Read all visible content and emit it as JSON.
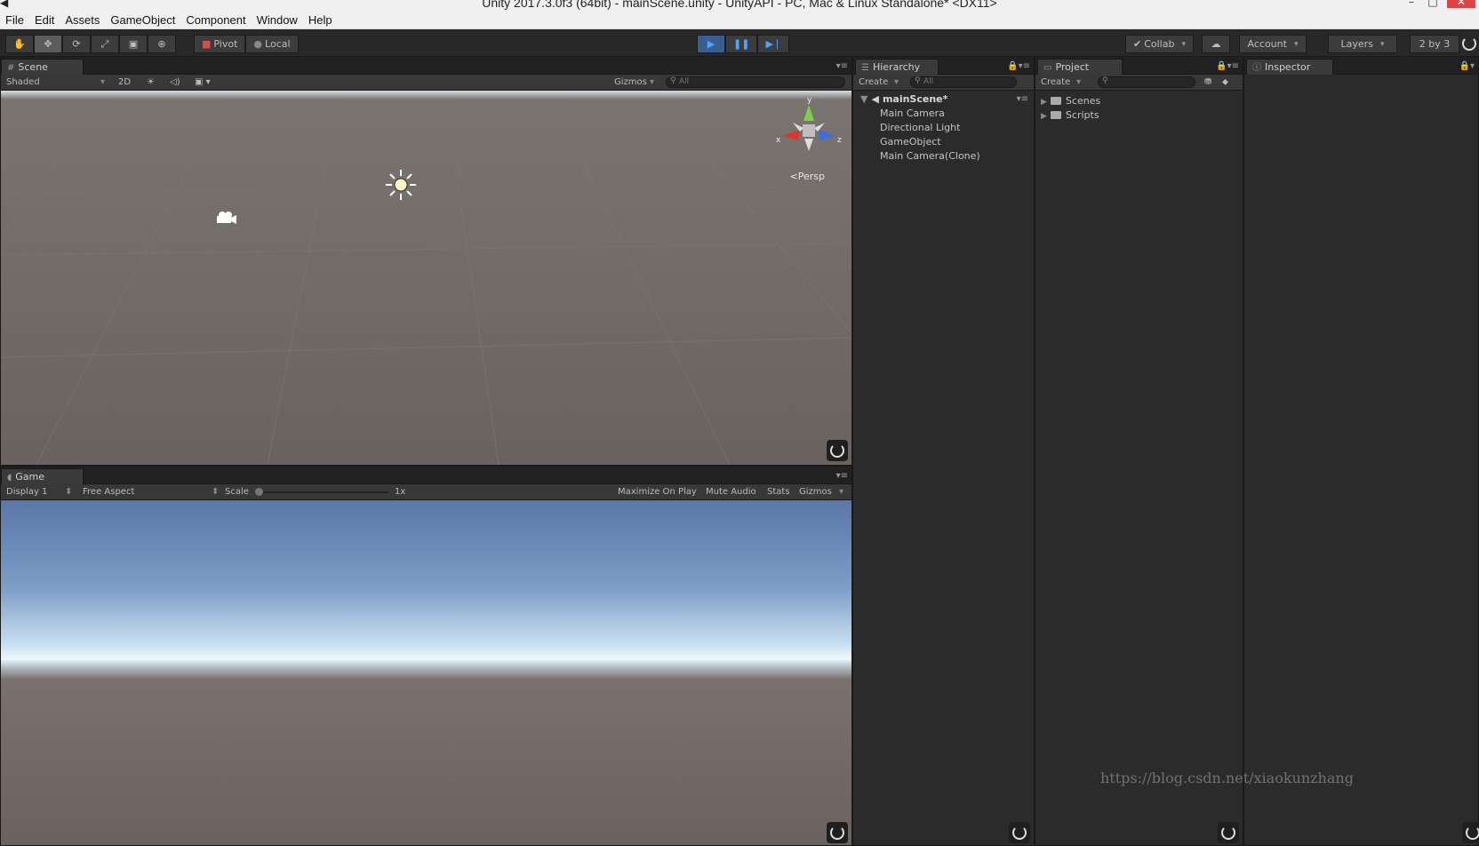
{
  "window": {
    "title": "Unity 2017.3.0f3 (64bit) - mainScene.unity - UnityAPI - PC, Mac & Linux Standalone* <DX11>"
  },
  "menu": [
    "File",
    "Edit",
    "Assets",
    "GameObject",
    "Component",
    "Window",
    "Help"
  ],
  "toolbar": {
    "tools": [
      "hand-tool",
      "move-tool",
      "rotate-tool",
      "scale-tool",
      "rect-tool",
      "transform-tool"
    ],
    "pivot_label": "Pivot",
    "local_label": "Local",
    "collab_label": "Collab",
    "account_label": "Account",
    "layers_label": "Layers",
    "layout_label": "2 by 3"
  },
  "scene": {
    "tab_label": "Scene",
    "shading": "Shaded",
    "mode_2d": "2D",
    "gizmos_label": "Gizmos",
    "search_placeholder": "All",
    "projection_label": "Persp",
    "axis_labels": [
      "y",
      "x",
      "z"
    ]
  },
  "game": {
    "tab_label": "Game",
    "display": "Display 1",
    "aspect": "Free Aspect",
    "scale_label": "Scale",
    "scale_value": "1x",
    "maximize_label": "Maximize On Play",
    "mute_label": "Mute Audio",
    "stats_label": "Stats",
    "gizmos_label": "Gizmos"
  },
  "hierarchy": {
    "tab_label": "Hierarchy",
    "create_label": "Create",
    "search_placeholder": "All",
    "scene_name": "mainScene*",
    "items": [
      "Main Camera",
      "Directional Light",
      "GameObject",
      "Main Camera(Clone)"
    ]
  },
  "project": {
    "tab_label": "Project",
    "create_label": "Create",
    "folders": [
      "Scenes",
      "Scripts"
    ]
  },
  "inspector": {
    "tab_label": "Inspector"
  },
  "watermark": "https://blog.csdn.net/xiaokunzhang"
}
